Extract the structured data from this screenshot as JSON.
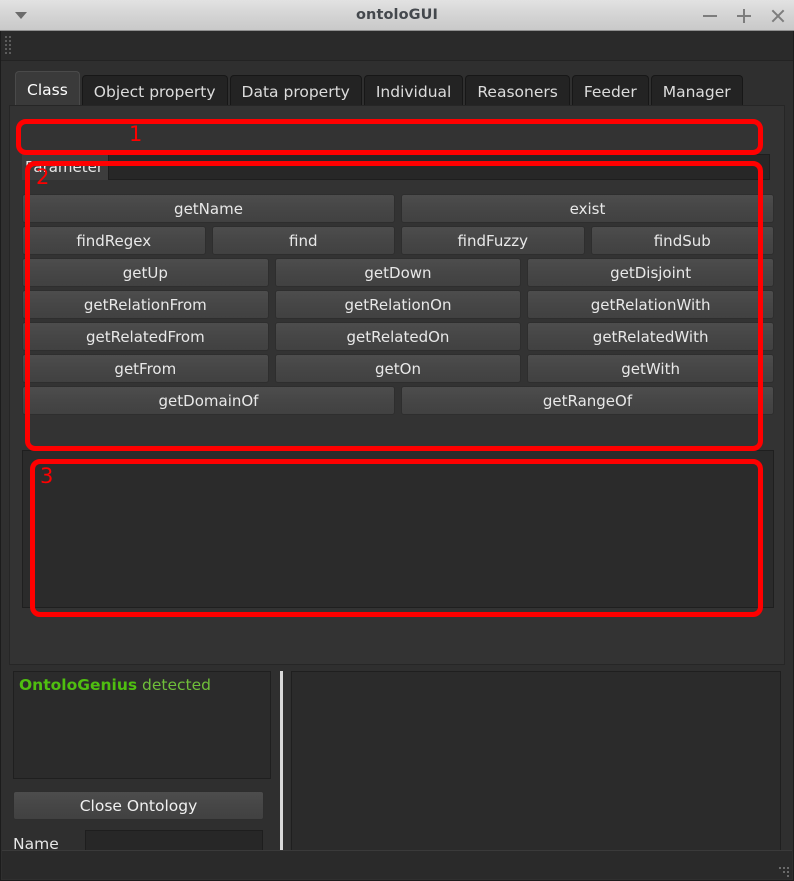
{
  "window": {
    "title": "ontoloGUI",
    "menu_icon": "chevron-down-icon",
    "minimize_icon": "minimize-icon",
    "maximize_icon": "maximize-icon",
    "close_icon": "close-icon",
    "accent_red": "#ff0000",
    "status_green": "#4fbf10"
  },
  "tabs": [
    {
      "label": "Class",
      "active": true
    },
    {
      "label": "Object property",
      "active": false
    },
    {
      "label": "Data property",
      "active": false
    },
    {
      "label": "Individual",
      "active": false
    },
    {
      "label": "Reasoners",
      "active": false
    },
    {
      "label": "Feeder",
      "active": false
    },
    {
      "label": "Manager",
      "active": false
    }
  ],
  "parameter": {
    "label": "Parameter",
    "value": "",
    "placeholder": ""
  },
  "button_grid": [
    {
      "cols": 2,
      "buttons": [
        "getName",
        "exist"
      ]
    },
    {
      "cols": 4,
      "buttons": [
        "findRegex",
        "find",
        "findFuzzy",
        "findSub"
      ]
    },
    {
      "cols": 3,
      "buttons": [
        "getUp",
        "getDown",
        "getDisjoint"
      ]
    },
    {
      "cols": 3,
      "buttons": [
        "getRelationFrom",
        "getRelationOn",
        "getRelationWith"
      ]
    },
    {
      "cols": 3,
      "buttons": [
        "getRelatedFrom",
        "getRelatedOn",
        "getRelatedWith"
      ]
    },
    {
      "cols": 3,
      "buttons": [
        "getFrom",
        "getOn",
        "getWith"
      ]
    },
    {
      "cols": 2,
      "buttons": [
        "getDomainOf",
        "getRangeOf"
      ]
    }
  ],
  "output": {
    "text": ""
  },
  "bottom": {
    "status_strong": "OntoloGenius",
    "status_rest": " detected",
    "close_ontology_label": "Close Ontology",
    "name_label": "Name",
    "name_value": "",
    "name_placeholder": "",
    "right_panel_text": ""
  },
  "annotations": [
    {
      "number": "1"
    },
    {
      "number": "2"
    },
    {
      "number": "3"
    }
  ]
}
